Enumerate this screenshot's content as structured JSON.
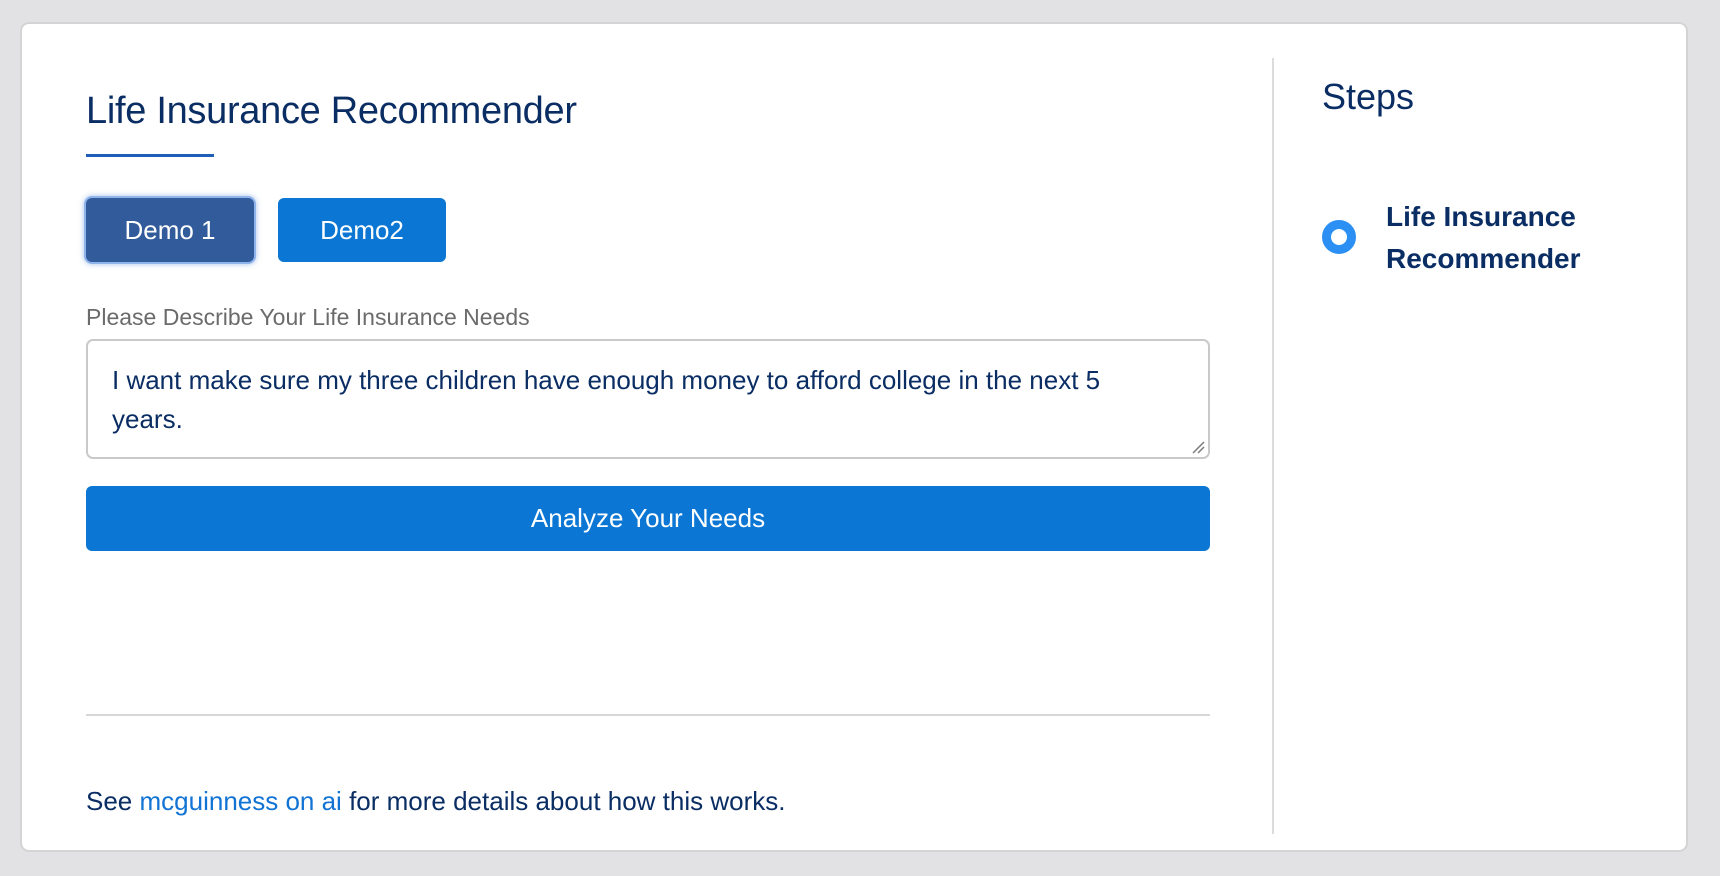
{
  "main": {
    "title": "Life Insurance Recommender",
    "demo_buttons": [
      {
        "label": "Demo 1"
      },
      {
        "label": "Demo2"
      }
    ],
    "field_label": "Please Describe Your Life Insurance Needs",
    "textarea_value": "I want make sure my three children have enough money to afford college in the next 5 years.",
    "analyze_label": "Analyze Your Needs",
    "footer": {
      "prefix": "See ",
      "link_text": "mcguinness on ai",
      "suffix": " for more details about how this works."
    }
  },
  "steps": {
    "title": "Steps",
    "items": [
      {
        "label": "Life Insurance Recommender"
      }
    ]
  },
  "colors": {
    "primary": "#0b76d3",
    "active_demo": "#315b9a",
    "text_dark": "#0a2d63",
    "link": "#1173d4",
    "step_indicator": "#2c8ff3"
  }
}
